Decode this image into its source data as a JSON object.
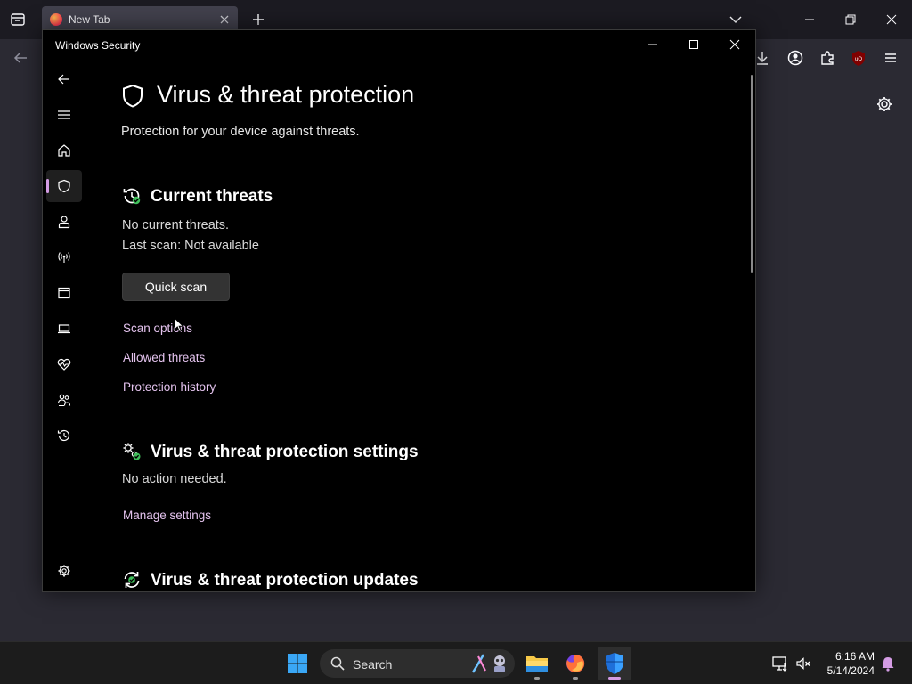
{
  "browser": {
    "tab_title": "New Tab"
  },
  "window": {
    "title": "Windows Security"
  },
  "page": {
    "title": "Virus & threat protection",
    "subtitle": "Protection for your device against threats."
  },
  "current_threats": {
    "title": "Current threats",
    "status": "No current threats.",
    "last_scan": "Last scan: Not available",
    "quick_scan_label": "Quick scan",
    "links": [
      "Scan options",
      "Allowed threats",
      "Protection history"
    ]
  },
  "settings_section": {
    "title": "Virus & threat protection settings",
    "status": "No action needed.",
    "link": "Manage settings"
  },
  "updates_section": {
    "title": "Virus & threat protection updates"
  },
  "sidebar": {
    "items": [
      "back-icon",
      "menu-icon",
      "home-icon",
      "shield-icon",
      "account-icon",
      "firewall-network-icon",
      "app-browser-control-icon",
      "device-security-icon",
      "device-health-icon",
      "family-options-icon",
      "protection-history-icon",
      "settings-icon"
    ],
    "active": "shield-icon"
  },
  "taskbar": {
    "search_label": "Search",
    "time": "6:16 AM",
    "date": "5/14/2024"
  },
  "colors": {
    "accent": "#d49ce4",
    "link": "#e4c3ee",
    "ok_green": "#3fbf5a"
  }
}
